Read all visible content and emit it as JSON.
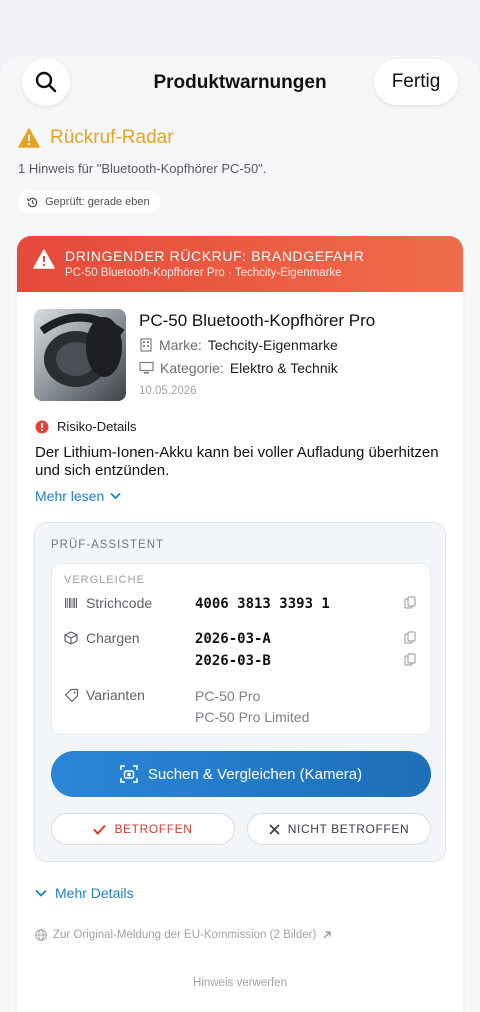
{
  "header": {
    "title": "Produktwarnungen",
    "done_label": "Fertig"
  },
  "radar": {
    "title": "Rückruf-Radar",
    "hint_count_text": "1 Hinweis für \"Bluetooth-Kopfhörer PC-50\".",
    "checked_label": "Geprüft: gerade eben"
  },
  "alert": {
    "banner_title": "DRINGENDER RÜCKRUF: BRANDGEFAHR",
    "banner_subtitle": "PC-50 Bluetooth-Kopfhörer Pro · Techcity-Eigenmarke",
    "product_name": "PC-50 Bluetooth-Kopfhörer Pro",
    "brand_label": "Marke:",
    "brand_value": "Techcity-Eigenmarke",
    "category_label": "Kategorie:",
    "category_value": "Elektro & Technik",
    "date": "10.05.2026",
    "risk_heading": "Risiko-Details",
    "risk_text": "Der Lithium-Ionen-Akku kann bei voller Aufladung überhitzen und sich entzünden.",
    "read_more": "Mehr lesen"
  },
  "assistant": {
    "label": "PRÜF-ASSISTENT",
    "compare_label": "VERGLEICHE",
    "barcode_label": "Strichcode",
    "barcode_value": "4006 3813 3393 1",
    "batches_label": "Chargen",
    "batches": [
      "2026-03-A",
      "2026-03-B"
    ],
    "variants_label": "Varianten",
    "variants": [
      "PC-50 Pro",
      "PC-50 Pro Limited"
    ],
    "scan_button": "Suchen & Vergleichen (Kamera)",
    "affected_button": "BETROFFEN",
    "not_affected_button": "NICHT BETROFFEN"
  },
  "footer": {
    "more_details": "Mehr Details",
    "original_link": "Zur Original-Meldung der EU-Kommission (2 Bilder)",
    "dismiss": "Hinweis verwerfen"
  },
  "colors": {
    "accent_blue": "#1f7fc9",
    "warning_orange": "#e8a224",
    "danger_red": "#e5493a"
  }
}
